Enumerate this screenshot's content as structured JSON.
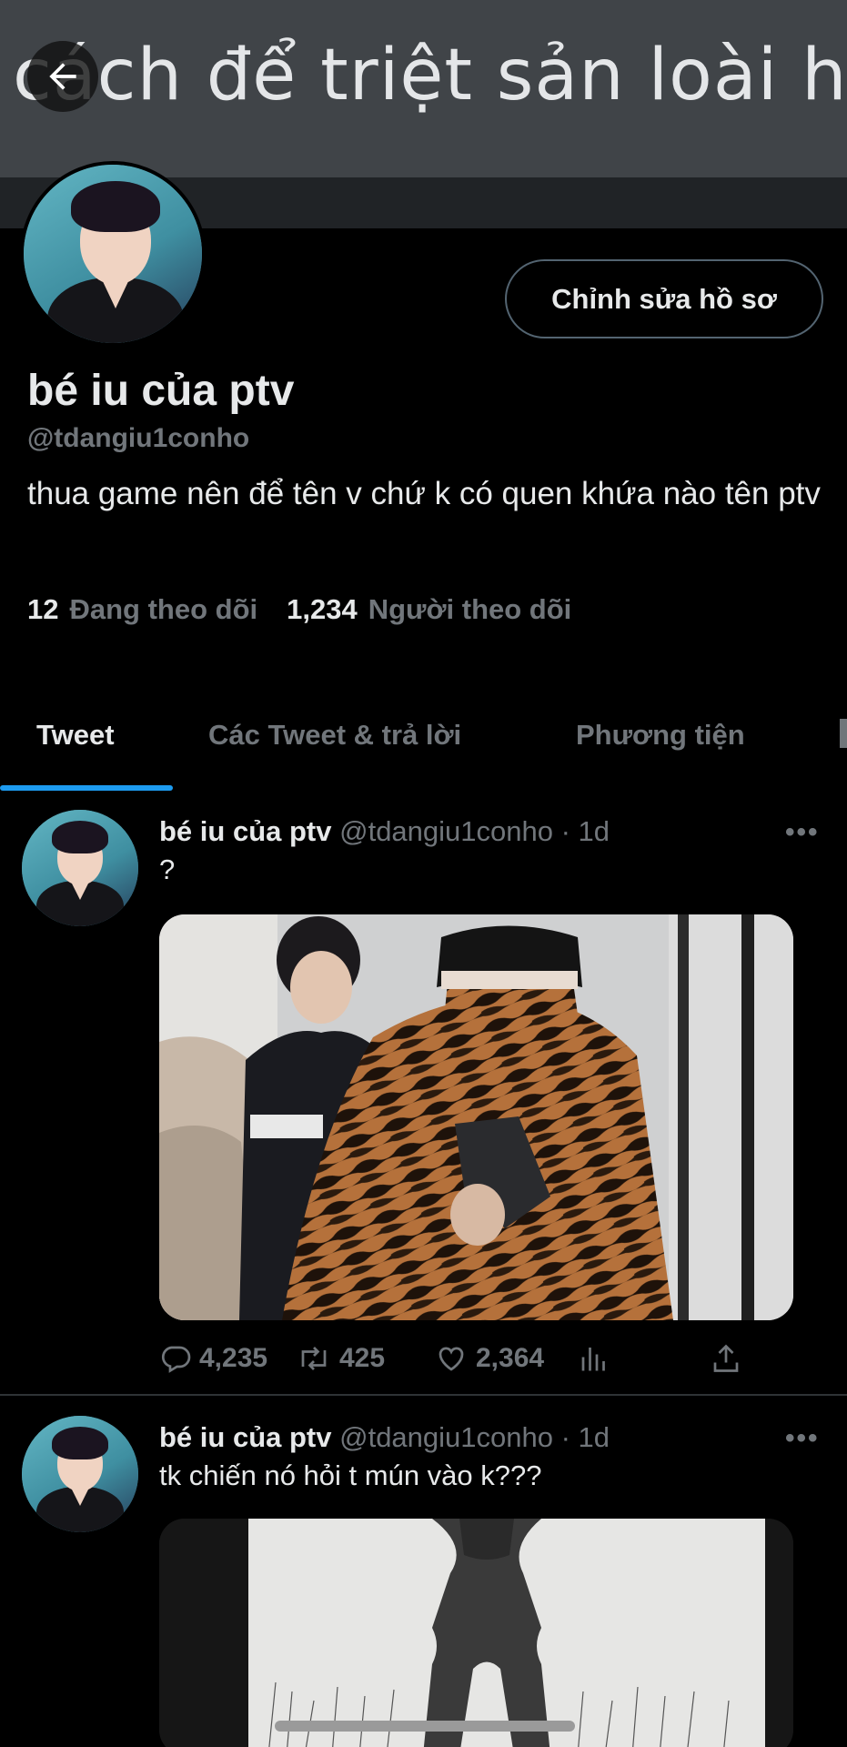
{
  "banner": {
    "text": "cách để triệt sản loài hổ"
  },
  "profile": {
    "edit_label": "Chỉnh sửa hồ sơ",
    "display_name": "bé iu của ptv",
    "handle": "@tdangiu1conho",
    "bio": "thua game nên để tên v chứ k có quen khứa nào tên ptv",
    "following_count": "12",
    "following_label": "Đang theo dõi",
    "followers_count": "1,234",
    "followers_label": "Người theo dõi"
  },
  "tabs": [
    "Tweet",
    "Các Tweet & trả lời",
    "Phương tiện"
  ],
  "tweets": [
    {
      "name": "bé iu của ptv",
      "meta": "@tdangiu1conho · 1d",
      "text": "?",
      "replies": "4,235",
      "retweets": "425",
      "likes": "2,364"
    },
    {
      "name": "bé iu của ptv",
      "meta": "@tdangiu1conho · 1d",
      "text": "tk chiến nó hỏi t mún vào k???"
    }
  ],
  "more_glyph": "•••",
  "colors": {
    "accent": "#1d9bf0",
    "muted": "#71767b",
    "text": "#e7e9ea",
    "background": "#000000"
  },
  "icons": [
    "back-arrow-icon",
    "more-icon",
    "reply-icon",
    "retweet-icon",
    "like-icon",
    "views-icon",
    "share-icon"
  ]
}
